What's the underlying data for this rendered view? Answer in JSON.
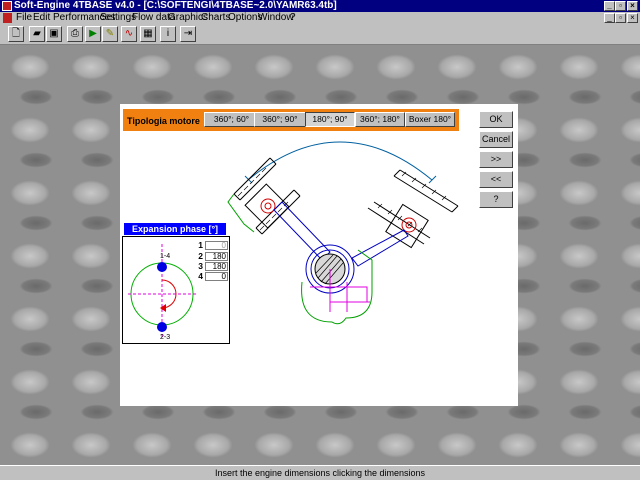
{
  "window": {
    "title": "Soft-Engine 4TBASE v4.0 - [C:\\SOFTENGI\\4TBASE~2.0\\YAMR63.4tb]"
  },
  "menu": [
    "File",
    "Edit",
    "Performances",
    "Settings",
    "Flow data",
    "Graphics",
    "Charts",
    "Options",
    "Window",
    "?"
  ],
  "tipologia": {
    "label": "Tipologia motore",
    "options": [
      "360°; 60°",
      "360°; 90°",
      "180°; 90°",
      "360°; 180°",
      "Boxer 180°"
    ],
    "selected": "180°; 90°"
  },
  "side_buttons": {
    "ok": "OK",
    "cancel": "Cancel",
    "next": ">>",
    "prev": "<<",
    "help": "?"
  },
  "expansion": {
    "title": "Expansion phase [°]",
    "top_label": "1-4",
    "bottom_label": "2-3",
    "cylinders": [
      {
        "num": "1",
        "value": "0",
        "dim": true
      },
      {
        "num": "2",
        "value": "180",
        "dim": false
      },
      {
        "num": "3",
        "value": "180",
        "dim": false
      },
      {
        "num": "4",
        "value": "0",
        "dim": false
      }
    ]
  },
  "status": {
    "text": "Insert the engine dimensions clicking the dimensions"
  },
  "colors": {
    "title_bg": "#000080",
    "tipologia_bg": "#f08010",
    "expansion_title_bg": "#0000ff"
  }
}
